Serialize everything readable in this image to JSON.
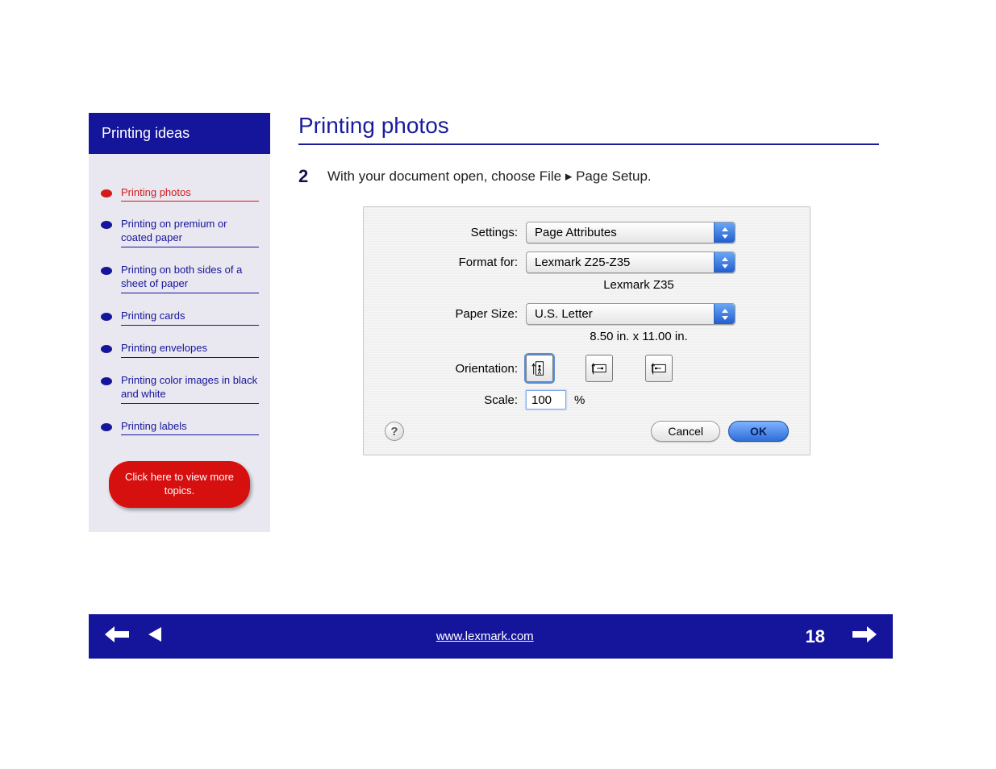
{
  "sidebar": {
    "title": "Printing ideas",
    "items": [
      {
        "label": "Printing photos",
        "active": true
      },
      {
        "label": "Printing on premium or coated paper",
        "active": false
      },
      {
        "label": "Printing on both sides of a sheet of paper",
        "active": false
      },
      {
        "label": "Printing cards",
        "active": false
      },
      {
        "label": "Printing envelopes",
        "active": false
      },
      {
        "label": "Printing color images in black and white",
        "active": false
      },
      {
        "label": "Printing labels",
        "active": false
      }
    ],
    "cta": "Click here to view more topics."
  },
  "main": {
    "title": "Printing photos",
    "step_number": "2",
    "step_text": "With your document open, choose File ▸ Page Setup."
  },
  "dialog": {
    "settings_label": "Settings:",
    "settings_value": "Page Attributes",
    "format_label": "Format for:",
    "format_value": "Lexmark Z25-Z35",
    "format_sub": "Lexmark Z35",
    "papersize_label": "Paper Size:",
    "papersize_value": "U.S. Letter",
    "papersize_sub": "8.50 in. x 11.00 in.",
    "orientation_label": "Orientation:",
    "scale_label": "Scale:",
    "scale_value": "100",
    "scale_suffix": "%",
    "help_glyph": "?",
    "cancel": "Cancel",
    "ok": "OK"
  },
  "nav": {
    "center_link": "www.lexmark.com",
    "page_number": "18"
  }
}
